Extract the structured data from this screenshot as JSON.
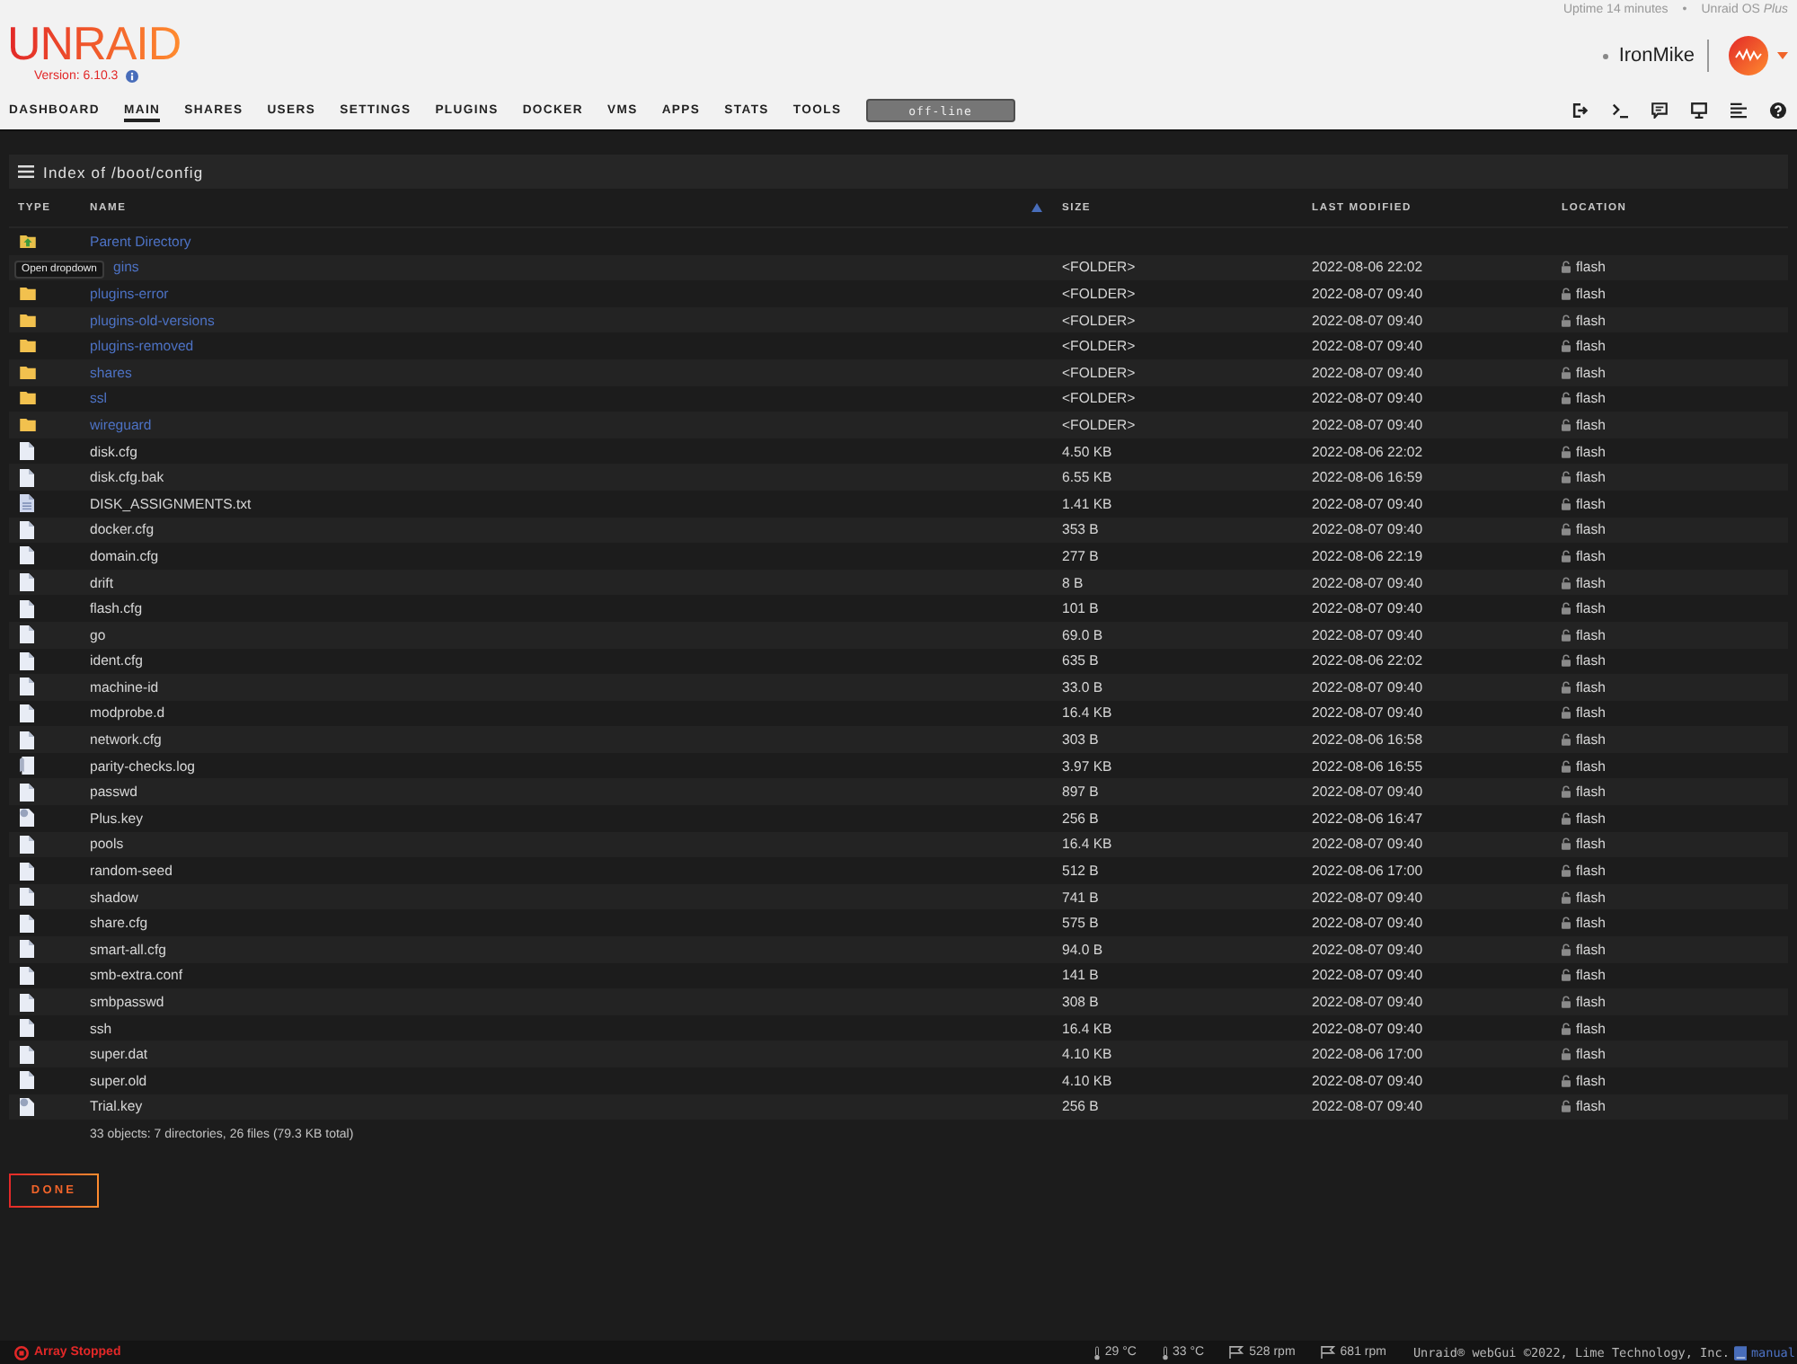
{
  "header": {
    "logo": "UNRAID",
    "version": "Version: 6.10.3",
    "uptime": "Uptime 14 minutes",
    "separator": "•",
    "edition": "Unraid OS *Plus*",
    "username": "IronMike"
  },
  "nav": {
    "items": [
      {
        "label": "DASHBOARD",
        "selected": false
      },
      {
        "label": "MAIN",
        "selected": true
      },
      {
        "label": "SHARES",
        "selected": false
      },
      {
        "label": "USERS",
        "selected": false
      },
      {
        "label": "SETTINGS",
        "selected": false
      },
      {
        "label": "PLUGINS",
        "selected": false
      },
      {
        "label": "DOCKER",
        "selected": false
      },
      {
        "label": "VMS",
        "selected": false
      },
      {
        "label": "APPS",
        "selected": false
      },
      {
        "label": "STATS",
        "selected": false
      },
      {
        "label": "TOOLS",
        "selected": false
      }
    ],
    "status": "off-line",
    "tools": [
      {
        "kind": "logout"
      },
      {
        "kind": "terminal"
      },
      {
        "kind": "feedback"
      },
      {
        "kind": "monitor"
      },
      {
        "kind": "log"
      },
      {
        "kind": "help"
      }
    ]
  },
  "browser": {
    "title": "Index of /boot/config",
    "columns": [
      {
        "label": "TYPE",
        "sorted": false
      },
      {
        "label": "NAME",
        "sorted": true
      },
      {
        "label": "SIZE",
        "sorted": false
      },
      {
        "label": "LAST MODIFIED",
        "sorted": false
      },
      {
        "label": "LOCATION",
        "sorted": false
      }
    ],
    "rows": [
      {
        "kind": "parent",
        "name": "Parent Directory"
      },
      {
        "kind": "folder",
        "name": "gins",
        "tooltip": "Open dropdown",
        "size": "<FOLDER>",
        "modified": "2022-08-06 22:02",
        "location": "flash"
      },
      {
        "kind": "folder",
        "name": "plugins-error",
        "size": "<FOLDER>",
        "modified": "2022-08-07 09:40",
        "location": "flash"
      },
      {
        "kind": "folder",
        "name": "plugins-old-versions",
        "size": "<FOLDER>",
        "modified": "2022-08-07 09:40",
        "location": "flash"
      },
      {
        "kind": "folder",
        "name": "plugins-removed",
        "size": "<FOLDER>",
        "modified": "2022-08-07 09:40",
        "location": "flash"
      },
      {
        "kind": "folder",
        "name": "shares",
        "size": "<FOLDER>",
        "modified": "2022-08-07 09:40",
        "location": "flash"
      },
      {
        "kind": "folder",
        "name": "ssl",
        "size": "<FOLDER>",
        "modified": "2022-08-07 09:40",
        "location": "flash"
      },
      {
        "kind": "folder",
        "name": "wireguard",
        "size": "<FOLDER>",
        "modified": "2022-08-07 09:40",
        "location": "flash"
      },
      {
        "kind": "file",
        "name": "disk.cfg",
        "size": "4.50 KB",
        "modified": "2022-08-06 22:02",
        "location": "flash"
      },
      {
        "kind": "file",
        "name": "disk.cfg.bak",
        "size": "6.55 KB",
        "modified": "2022-08-06 16:59",
        "location": "flash"
      },
      {
        "kind": "text",
        "name": "DISK_ASSIGNMENTS.txt",
        "size": "1.41 KB",
        "modified": "2022-08-07 09:40",
        "location": "flash"
      },
      {
        "kind": "file",
        "name": "docker.cfg",
        "size": "353 B",
        "modified": "2022-08-07 09:40",
        "location": "flash"
      },
      {
        "kind": "file",
        "name": "domain.cfg",
        "size": "277 B",
        "modified": "2022-08-06 22:19",
        "location": "flash"
      },
      {
        "kind": "file",
        "name": "drift",
        "size": "8 B",
        "modified": "2022-08-07 09:40",
        "location": "flash"
      },
      {
        "kind": "file",
        "name": "flash.cfg",
        "size": "101 B",
        "modified": "2022-08-07 09:40",
        "location": "flash"
      },
      {
        "kind": "file",
        "name": "go",
        "size": "69.0 B",
        "modified": "2022-08-07 09:40",
        "location": "flash"
      },
      {
        "kind": "file",
        "name": "ident.cfg",
        "size": "635 B",
        "modified": "2022-08-06 22:02",
        "location": "flash"
      },
      {
        "kind": "file",
        "name": "machine-id",
        "size": "33.0 B",
        "modified": "2022-08-07 09:40",
        "location": "flash"
      },
      {
        "kind": "file",
        "name": "modprobe.d",
        "size": "16.4 KB",
        "modified": "2022-08-07 09:40",
        "location": "flash"
      },
      {
        "kind": "file",
        "name": "network.cfg",
        "size": "303 B",
        "modified": "2022-08-06 16:58",
        "location": "flash"
      },
      {
        "kind": "log",
        "name": "parity-checks.log",
        "size": "3.97 KB",
        "modified": "2022-08-06 16:55",
        "location": "flash"
      },
      {
        "kind": "file",
        "name": "passwd",
        "size": "897 B",
        "modified": "2022-08-07 09:40",
        "location": "flash"
      },
      {
        "kind": "key",
        "name": "Plus.key",
        "size": "256 B",
        "modified": "2022-08-06 16:47",
        "location": "flash"
      },
      {
        "kind": "file",
        "name": "pools",
        "size": "16.4 KB",
        "modified": "2022-08-07 09:40",
        "location": "flash"
      },
      {
        "kind": "file",
        "name": "random-seed",
        "size": "512 B",
        "modified": "2022-08-06 17:00",
        "location": "flash"
      },
      {
        "kind": "file",
        "name": "shadow",
        "size": "741 B",
        "modified": "2022-08-07 09:40",
        "location": "flash"
      },
      {
        "kind": "file",
        "name": "share.cfg",
        "size": "575 B",
        "modified": "2022-08-07 09:40",
        "location": "flash"
      },
      {
        "kind": "file",
        "name": "smart-all.cfg",
        "size": "94.0 B",
        "modified": "2022-08-07 09:40",
        "location": "flash"
      },
      {
        "kind": "file",
        "name": "smb-extra.conf",
        "size": "141 B",
        "modified": "2022-08-07 09:40",
        "location": "flash"
      },
      {
        "kind": "file",
        "name": "smbpasswd",
        "size": "308 B",
        "modified": "2022-08-07 09:40",
        "location": "flash"
      },
      {
        "kind": "file",
        "name": "ssh",
        "size": "16.4 KB",
        "modified": "2022-08-07 09:40",
        "location": "flash"
      },
      {
        "kind": "file",
        "name": "super.dat",
        "size": "4.10 KB",
        "modified": "2022-08-06 17:00",
        "location": "flash"
      },
      {
        "kind": "file",
        "name": "super.old",
        "size": "4.10 KB",
        "modified": "2022-08-07 09:40",
        "location": "flash"
      },
      {
        "kind": "key",
        "name": "Trial.key",
        "size": "256 B",
        "modified": "2022-08-07 09:40",
        "location": "flash"
      }
    ],
    "summary": "33 objects: 7 directories, 26 files (79.3 KB total)"
  },
  "done_button": "DONE",
  "status_bar": {
    "array": "Array Stopped",
    "sensors": [
      {
        "kind": "temp",
        "reading": "29 °C"
      },
      {
        "kind": "temp",
        "reading": "33 °C"
      },
      {
        "kind": "fan",
        "reading": "528 rpm"
      },
      {
        "kind": "fan",
        "reading": "681 rpm"
      }
    ],
    "copyright": "Unraid® webGui ©2022, Lime Technology, Inc.",
    "manual": "manual"
  }
}
